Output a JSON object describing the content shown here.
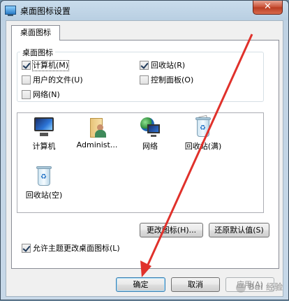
{
  "window": {
    "title": "桌面图标设置",
    "close_label": "✕"
  },
  "tab": {
    "label": "桌面图标"
  },
  "group": {
    "label": "桌面图标",
    "checkboxes": [
      {
        "label": "计算机(M)",
        "checked": true
      },
      {
        "label": "回收站(R)",
        "checked": true
      },
      {
        "label": "用户的文件(U)",
        "checked": false
      },
      {
        "label": "控制面板(O)",
        "checked": false
      },
      {
        "label": "网络(N)",
        "checked": false
      }
    ]
  },
  "icon_list": {
    "items": [
      {
        "label": "计算机",
        "icon": "computer-icon"
      },
      {
        "label": "Administ...",
        "icon": "user-folder-icon"
      },
      {
        "label": "网络",
        "icon": "network-icon"
      },
      {
        "label": "回收站(满)",
        "icon": "recycle-bin-full-icon"
      },
      {
        "label": "回收站(空)",
        "icon": "recycle-bin-empty-icon"
      }
    ]
  },
  "buttons": {
    "change_icon": "更改图标(H)...",
    "restore_default": "还原默认值(S)",
    "ok": "确定",
    "cancel": "取消",
    "apply": "应用(A)"
  },
  "allow_themes": {
    "label": "允许主题更改桌面图标(L)",
    "checked": true
  },
  "watermark": {
    "text": "Bai 经验"
  },
  "colors": {
    "arrow": "#e0312b",
    "title_bar": "#bfd2e3",
    "close_button": "#c74d32"
  }
}
